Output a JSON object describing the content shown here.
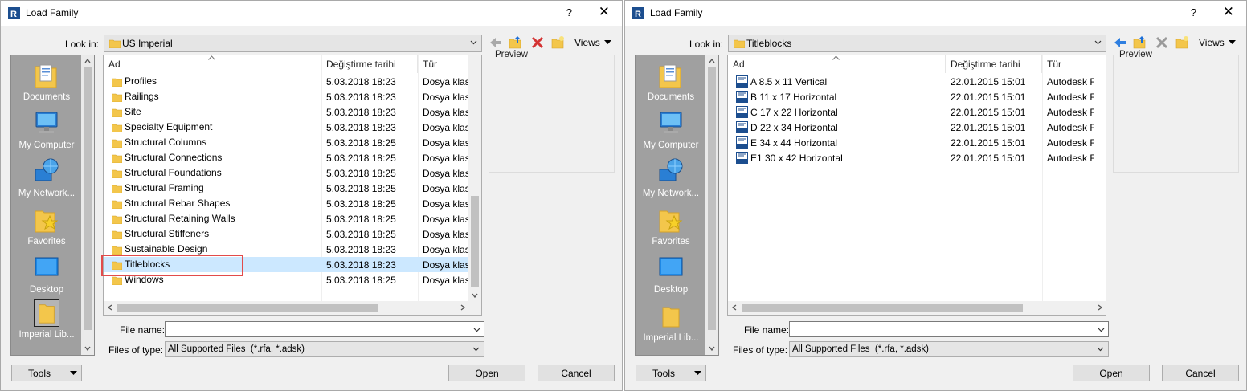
{
  "dialogs": [
    {
      "title": "Load Family",
      "help": "?",
      "close": "✕",
      "look_in_label": "Look in:",
      "look_in_value": "US Imperial",
      "views_label": "Views",
      "preview_label": "Preview",
      "places": [
        {
          "label": "Documents",
          "icon": "documents-icon"
        },
        {
          "label": "My Computer",
          "icon": "computer-icon"
        },
        {
          "label": "My Network...",
          "icon": "network-icon"
        },
        {
          "label": "Favorites",
          "icon": "favorites-icon"
        },
        {
          "label": "Desktop",
          "icon": "desktop-icon"
        },
        {
          "label": "Imperial Lib...",
          "icon": "library-folder-icon"
        }
      ],
      "columns": [
        "Ad",
        "Değiştirme tarihi",
        "Tür"
      ],
      "rows": [
        {
          "name": "Profiles",
          "date": "5.03.2018 18:23",
          "type": "Dosya klasörü"
        },
        {
          "name": "Railings",
          "date": "5.03.2018 18:23",
          "type": "Dosya klasörü"
        },
        {
          "name": "Site",
          "date": "5.03.2018 18:23",
          "type": "Dosya klasörü"
        },
        {
          "name": "Specialty Equipment",
          "date": "5.03.2018 18:23",
          "type": "Dosya klasörü"
        },
        {
          "name": "Structural Columns",
          "date": "5.03.2018 18:25",
          "type": "Dosya klasörü"
        },
        {
          "name": "Structural Connections",
          "date": "5.03.2018 18:25",
          "type": "Dosya klasörü"
        },
        {
          "name": "Structural Foundations",
          "date": "5.03.2018 18:25",
          "type": "Dosya klasörü"
        },
        {
          "name": "Structural Framing",
          "date": "5.03.2018 18:25",
          "type": "Dosya klasörü"
        },
        {
          "name": "Structural Rebar Shapes",
          "date": "5.03.2018 18:25",
          "type": "Dosya klasörü"
        },
        {
          "name": "Structural Retaining Walls",
          "date": "5.03.2018 18:25",
          "type": "Dosya klasörü"
        },
        {
          "name": "Structural Stiffeners",
          "date": "5.03.2018 18:25",
          "type": "Dosya klasörü"
        },
        {
          "name": "Sustainable Design",
          "date": "5.03.2018 18:23",
          "type": "Dosya klasörü"
        },
        {
          "name": "Titleblocks",
          "date": "5.03.2018 18:23",
          "type": "Dosya klasörü",
          "selected": true
        },
        {
          "name": "Windows",
          "date": "5.03.2018 18:25",
          "type": "Dosya klasörü"
        }
      ],
      "file_name_label": "File name:",
      "file_name_value": "",
      "files_of_type_label": "Files of type:",
      "files_of_type_value": "All Supported Files  (*.rfa, *.adsk)",
      "tools_label": "Tools",
      "open_label": "Open",
      "cancel_label": "Cancel"
    },
    {
      "title": "Load Family",
      "help": "?",
      "close": "✕",
      "look_in_label": "Look in:",
      "look_in_value": "Titleblocks",
      "views_label": "Views",
      "preview_label": "Preview",
      "places": [
        {
          "label": "Documents",
          "icon": "documents-icon"
        },
        {
          "label": "My Computer",
          "icon": "computer-icon"
        },
        {
          "label": "My Network...",
          "icon": "network-icon"
        },
        {
          "label": "Favorites",
          "icon": "favorites-icon"
        },
        {
          "label": "Desktop",
          "icon": "desktop-icon"
        },
        {
          "label": "Imperial Lib...",
          "icon": "library-folder-icon"
        }
      ],
      "columns": [
        "Ad",
        "Değiştirme tarihi",
        "Tür"
      ],
      "rows": [
        {
          "name": "A 8.5 x 11 Vertical",
          "date": "22.01.2015 15:01",
          "type": "Autodesk Revit Family"
        },
        {
          "name": "B 11 x 17 Horizontal",
          "date": "22.01.2015 15:01",
          "type": "Autodesk Revit Family"
        },
        {
          "name": "C 17 x 22 Horizontal",
          "date": "22.01.2015 15:01",
          "type": "Autodesk Revit Family"
        },
        {
          "name": "D 22 x 34 Horizontal",
          "date": "22.01.2015 15:01",
          "type": "Autodesk Revit Family"
        },
        {
          "name": "E 34 x 44 Horizontal",
          "date": "22.01.2015 15:01",
          "type": "Autodesk Revit Family"
        },
        {
          "name": "E1 30 x 42 Horizontal",
          "date": "22.01.2015 15:01",
          "type": "Autodesk Revit Family"
        }
      ],
      "file_name_label": "File name:",
      "file_name_value": "",
      "files_of_type_label": "Files of type:",
      "files_of_type_value": "All Supported Files  (*.rfa, *.adsk)",
      "tools_label": "Tools",
      "open_label": "Open",
      "cancel_label": "Cancel"
    }
  ],
  "colors": {
    "selection": "#cce8ff",
    "highlight_box": "#e24b4b",
    "places_bg": "#a0a0a0",
    "folder": "#f3c64b",
    "revit_blue": "#1c4e8f"
  }
}
